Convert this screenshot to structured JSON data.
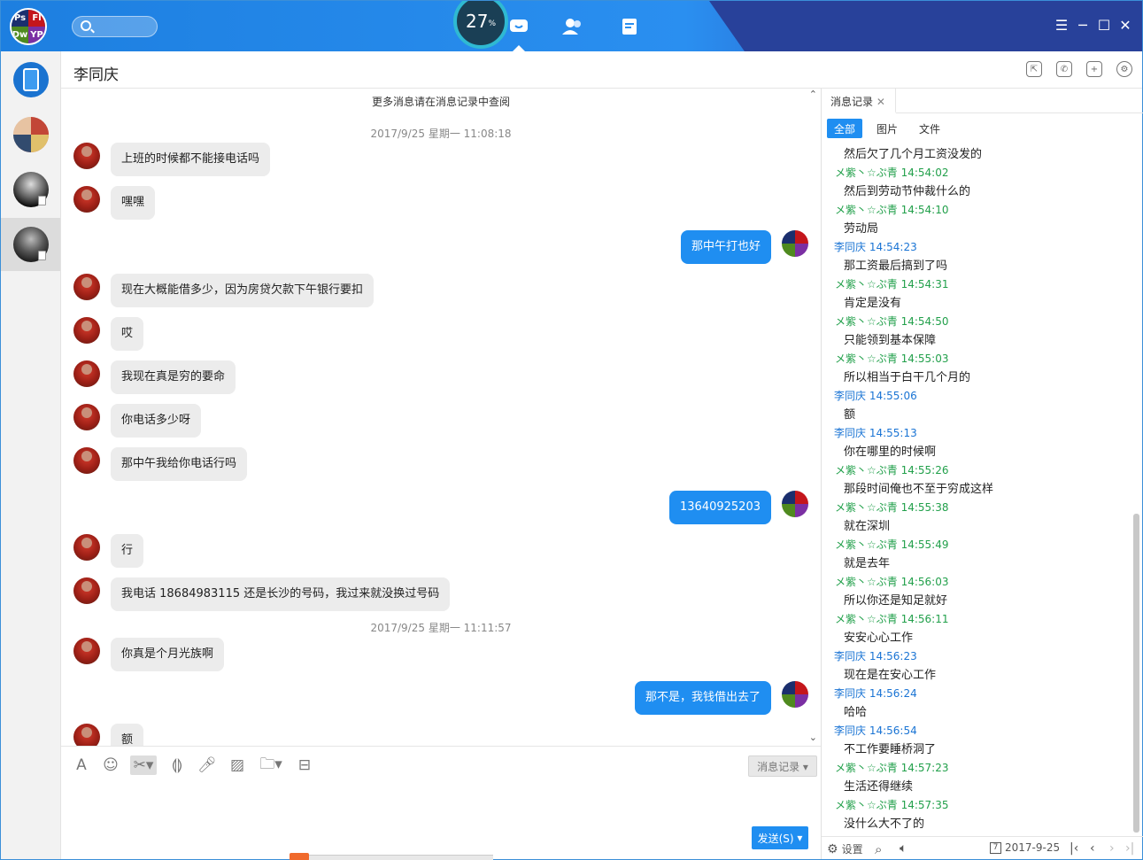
{
  "window": {
    "app_logo_letters": [
      "Ps",
      "Fl",
      "Dw",
      "YP"
    ],
    "gauge_value": "27",
    "gauge_unit": "%",
    "chat_title": "李同庆"
  },
  "messages_area": {
    "more_notice": "更多消息请在消息记录中查阅",
    "timestamp_1": "2017/9/25 星期一 11:08:18",
    "timestamp_2": "2017/9/25 星期一 11:11:57",
    "msgs": [
      "上班的时候都不能接电话吗",
      "嘿嘿",
      "那中午打也好",
      "现在大概能借多少，因为房贷欠款下午银行要扣",
      "哎",
      "我现在真是穷的要命",
      "你电话多少呀",
      "那中午我给你电话行吗",
      "13640925203",
      "行",
      "我电话 18684983115  还是长沙的号码，我过来就没换过号码",
      "你真是个月光族啊",
      "那不是，我钱借出去了",
      "额"
    ]
  },
  "input": {
    "history_btn": "消息记录 ▾",
    "send_btn": "发送(S)"
  },
  "history": {
    "tab_label": "消息记录",
    "filters": [
      "全部",
      "图片",
      "文件"
    ],
    "entries": [
      "然后欠了几个月工资没发的",
      "メ紫丶☆ぷ青 14:54:02",
      "然后到劳动节仲裁什么的",
      "メ紫丶☆ぷ青 14:54:10",
      "劳动局",
      "李同庆 14:54:23",
      "那工资最后搞到了吗",
      "メ紫丶☆ぷ青 14:54:31",
      "肯定是没有",
      "メ紫丶☆ぷ青 14:54:50",
      "只能领到基本保障",
      "メ紫丶☆ぷ青 14:55:03",
      "所以相当于白干几个月的",
      "李同庆 14:55:06",
      "额",
      "李同庆 14:55:13",
      "你在哪里的时候啊",
      "メ紫丶☆ぷ青 14:55:26",
      "那段时间俺也不至于穷成这样",
      "メ紫丶☆ぷ青 14:55:38",
      "就在深圳",
      "メ紫丶☆ぷ青 14:55:49",
      "就是去年",
      "メ紫丶☆ぷ青 14:56:03",
      "所以你还是知足就好",
      "メ紫丶☆ぷ青 14:56:11",
      "安安心心工作",
      "李同庆 14:56:23",
      "现在是在安心工作",
      "李同庆 14:56:24",
      "哈哈",
      "李同庆 14:56:54",
      "不工作要睡桥洞了",
      "メ紫丶☆ぷ青 14:57:23",
      "生活还得继续",
      "メ紫丶☆ぷ青 14:57:35",
      "没什么大不了的"
    ],
    "settings_label": "设置",
    "date_label": "2017-9-25",
    "calendar_day": "7"
  },
  "colors": {
    "accent": "#1f8ef1",
    "self_name": "#22a04b",
    "friend_name": "#1a74d4",
    "topbar": "#2a8ff0"
  }
}
